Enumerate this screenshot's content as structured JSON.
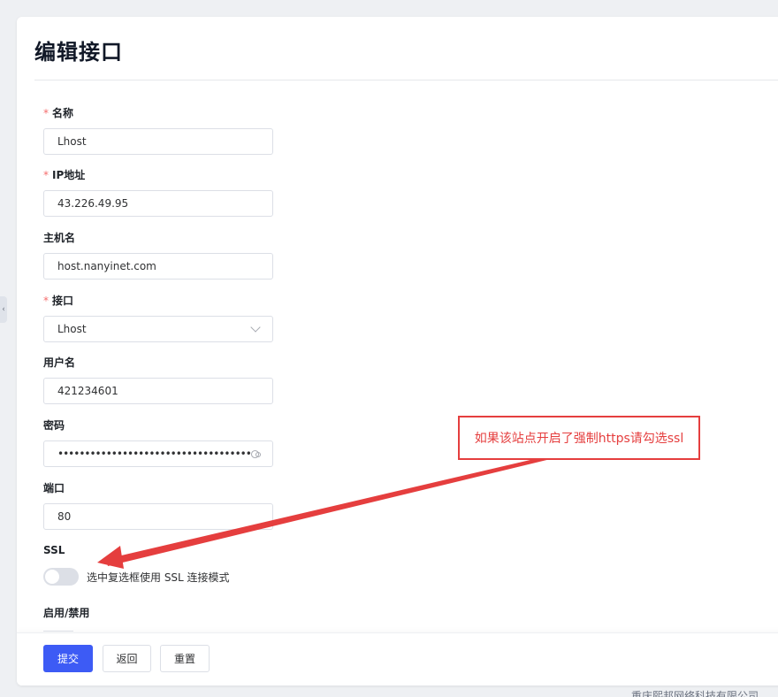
{
  "page": {
    "title": "编辑接口"
  },
  "form": {
    "name": {
      "label": "名称",
      "value": "Lhost",
      "required": true
    },
    "ip": {
      "label": "IP地址",
      "value": "43.226.49.95",
      "required": true
    },
    "hostname": {
      "label": "主机名",
      "value": "host.nanyinet.com",
      "required": false
    },
    "api": {
      "label": "接口",
      "value": "Lhost",
      "required": true
    },
    "username": {
      "label": "用户名",
      "value": "421234601",
      "required": false
    },
    "password": {
      "label": "密码",
      "value": "••••••••••••••••••••••••••••••••••••",
      "required": false
    },
    "port": {
      "label": "端口",
      "value": "80",
      "required": false
    },
    "ssl": {
      "label": "SSL",
      "checked": false,
      "description": "选中复选框使用 SSL 连接模式"
    },
    "enable": {
      "label": "启用/禁用"
    },
    "required_mark": "*"
  },
  "actions": {
    "submit": "提交",
    "back": "返回",
    "reset": "重置"
  },
  "annotation": {
    "text": "如果该站点开启了强制https请勾选ssl",
    "color": "#e53e3e"
  },
  "footer_text": "重庆熙邦网络科技有限公司",
  "colors": {
    "primary": "#3d5bf5",
    "required": "#f56c6c"
  }
}
